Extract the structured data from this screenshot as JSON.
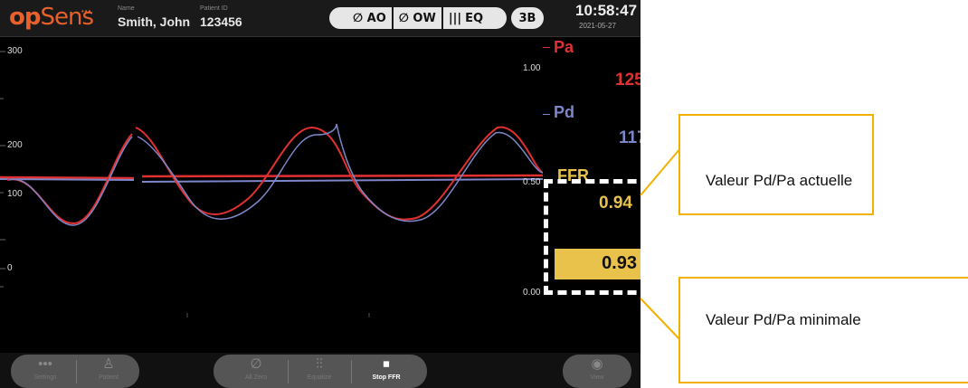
{
  "header": {
    "logo_op": "op",
    "logo_sens": "Sens",
    "logo_dots": "•••",
    "name_label": "Name",
    "name_value": "Smith, John",
    "pid_label": "Patient ID",
    "pid_value": "123456",
    "zero_ao": "∅ AO",
    "zero_ow": "∅ OW",
    "eq": "EQ",
    "mode": "3B",
    "time": "10:58:47",
    "date": "2021-05-27"
  },
  "plot": {
    "y_ticks": [
      "300",
      "200",
      "100",
      "0"
    ],
    "colors": {
      "pa": "#e03030",
      "pd": "#7d86c8",
      "ffr": "#e8c24a"
    }
  },
  "panel": {
    "pa_label": "Pa",
    "pa_value": "125",
    "pd_label": "Pd",
    "pd_value": "117",
    "ffr_label": "FFR",
    "ffr_value": "0.94",
    "ffr_min_value": "0.93",
    "scale_top": "1.00",
    "scale_mid": "0.50",
    "scale_bottom": "0.00"
  },
  "toolbar": {
    "settings": "Settings",
    "patient": "Patient",
    "all_zero": "All Zero",
    "equalize": "Equalize",
    "stop_ffr": "Stop FFR",
    "view": "View"
  },
  "callouts": {
    "current": "Valeur Pd/Pa actuelle",
    "minimum": "Valeur Pd/Pa minimale"
  }
}
